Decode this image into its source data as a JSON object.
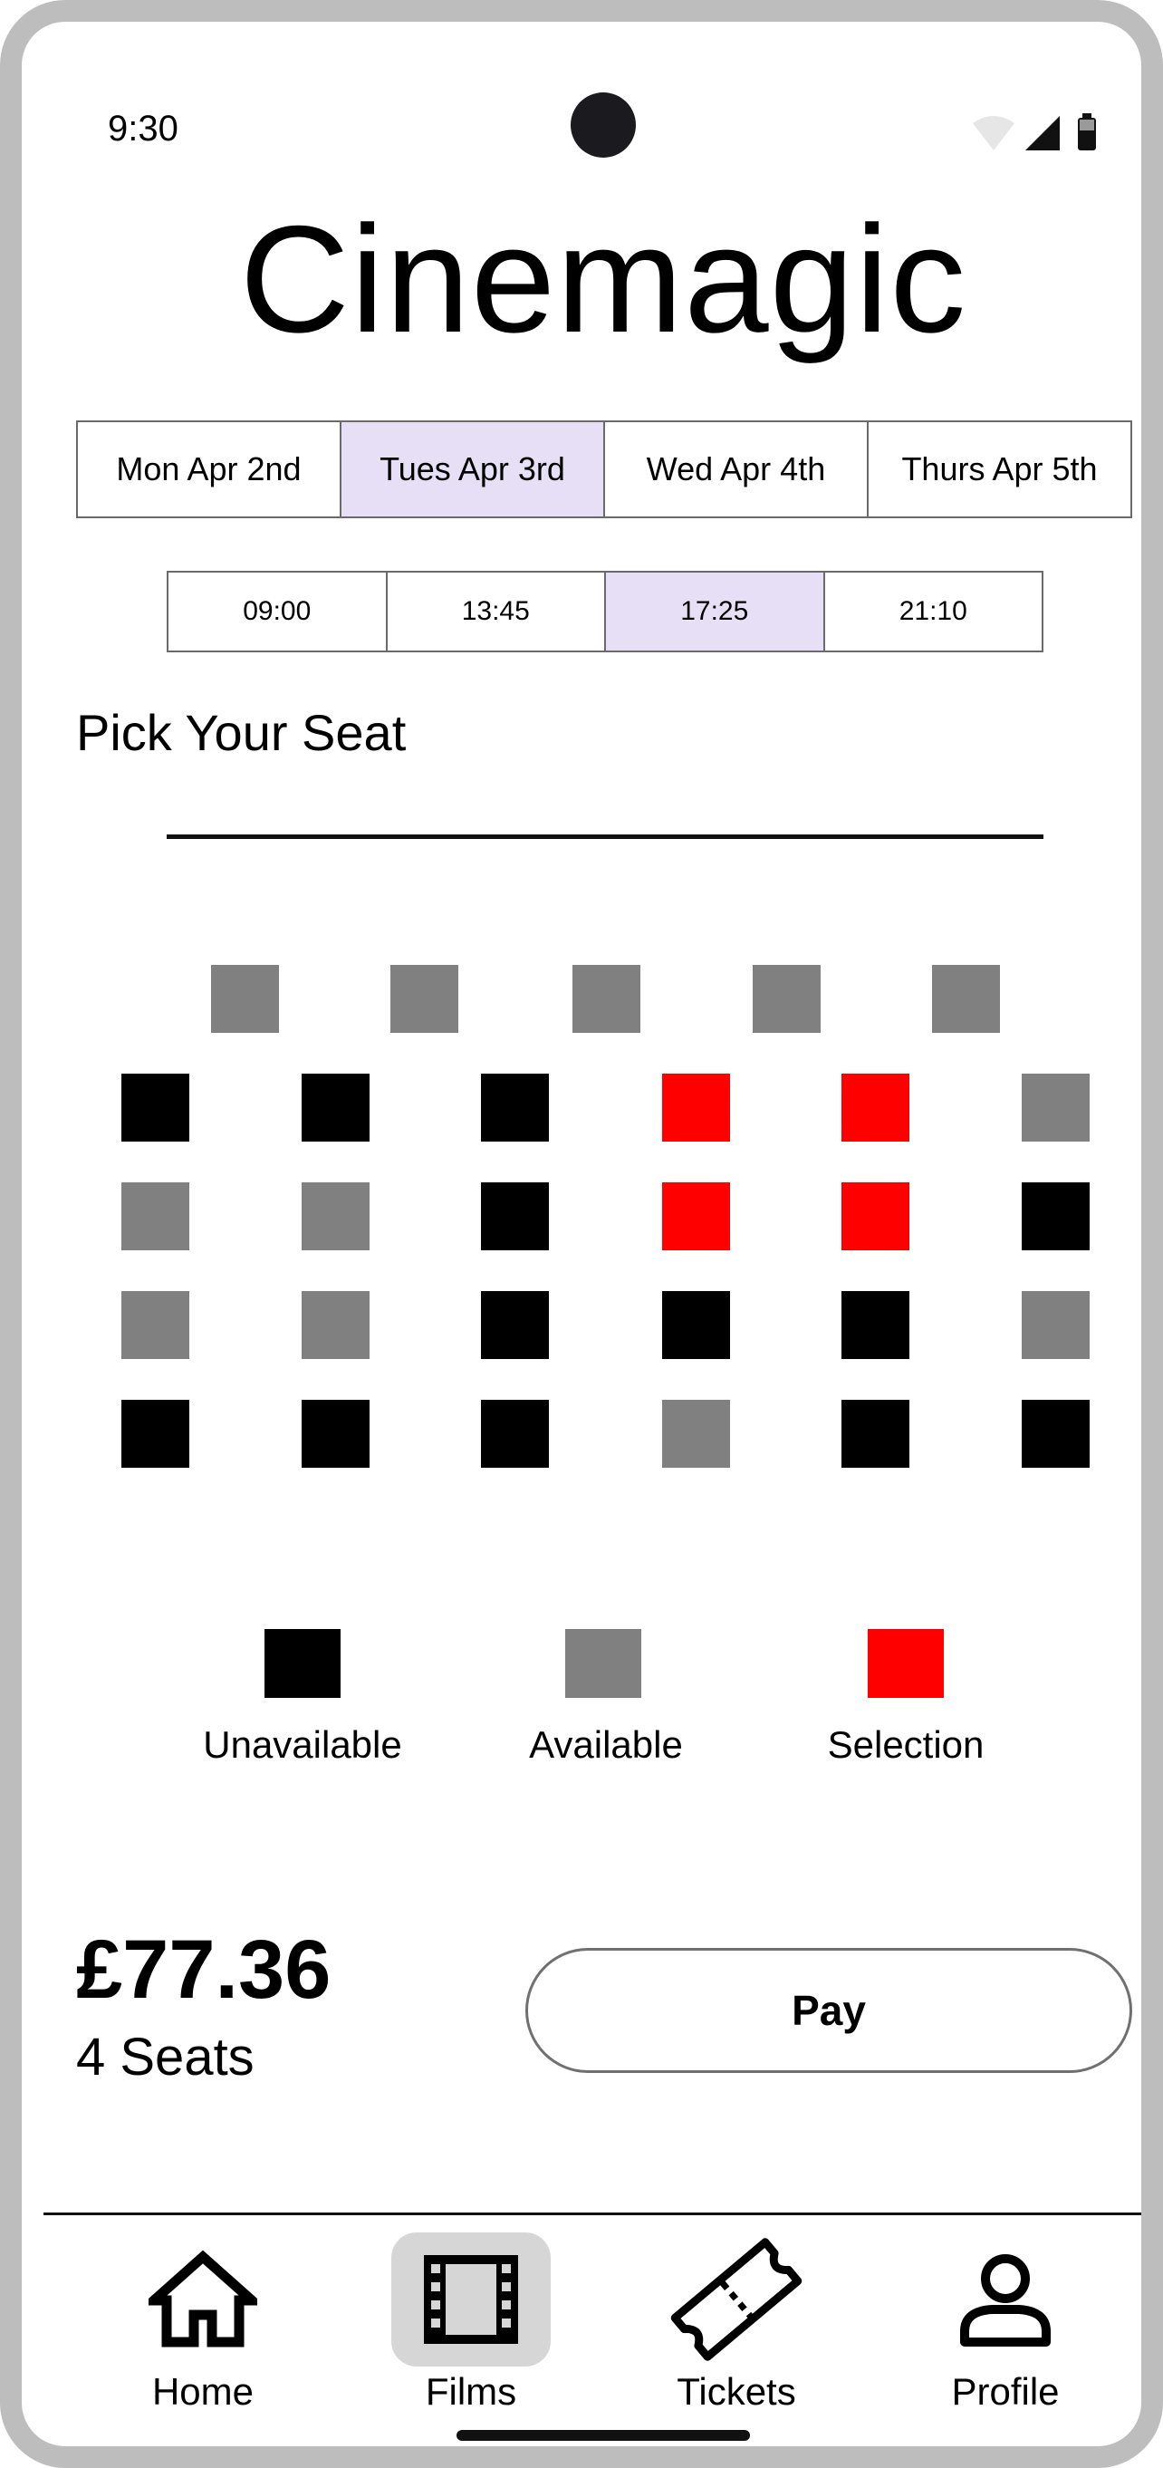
{
  "status_bar": {
    "time": "9:30"
  },
  "app": {
    "title": "Cinemagic"
  },
  "dates": [
    {
      "label": "Mon Apr 2nd",
      "selected": false
    },
    {
      "label": "Tues Apr 3rd",
      "selected": true
    },
    {
      "label": "Wed Apr 4th",
      "selected": false
    },
    {
      "label": "Thurs Apr 5th",
      "selected": false
    }
  ],
  "times": [
    {
      "label": "09:00",
      "selected": false
    },
    {
      "label": "13:45",
      "selected": false
    },
    {
      "label": "17:25",
      "selected": true
    },
    {
      "label": "21:10",
      "selected": false
    }
  ],
  "seat_section": {
    "title": "Pick Your Seat"
  },
  "seat_rows": [
    [
      "available",
      "available",
      "available",
      "available",
      "available"
    ],
    [
      "unavailable",
      "unavailable",
      "unavailable",
      "selection",
      "selection",
      "available"
    ],
    [
      "available",
      "available",
      "unavailable",
      "selection",
      "selection",
      "unavailable"
    ],
    [
      "available",
      "available",
      "unavailable",
      "unavailable",
      "unavailable",
      "available"
    ],
    [
      "unavailable",
      "unavailable",
      "unavailable",
      "available",
      "unavailable",
      "unavailable"
    ]
  ],
  "legend": {
    "unavailable": "Unavailable",
    "available": "Available",
    "selection": "Selection"
  },
  "summary": {
    "price": "£77.36",
    "seats": "4 Seats",
    "pay_label": "Pay"
  },
  "nav": {
    "home": "Home",
    "films": "Films",
    "tickets": "Tickets",
    "profile": "Profile",
    "active": "films"
  },
  "colors": {
    "selected_tab": "#e7dff6",
    "seat_available": "#808080",
    "seat_unavailable": "#000000",
    "seat_selection": "#ff0000",
    "frame": "#bdbdbd"
  }
}
